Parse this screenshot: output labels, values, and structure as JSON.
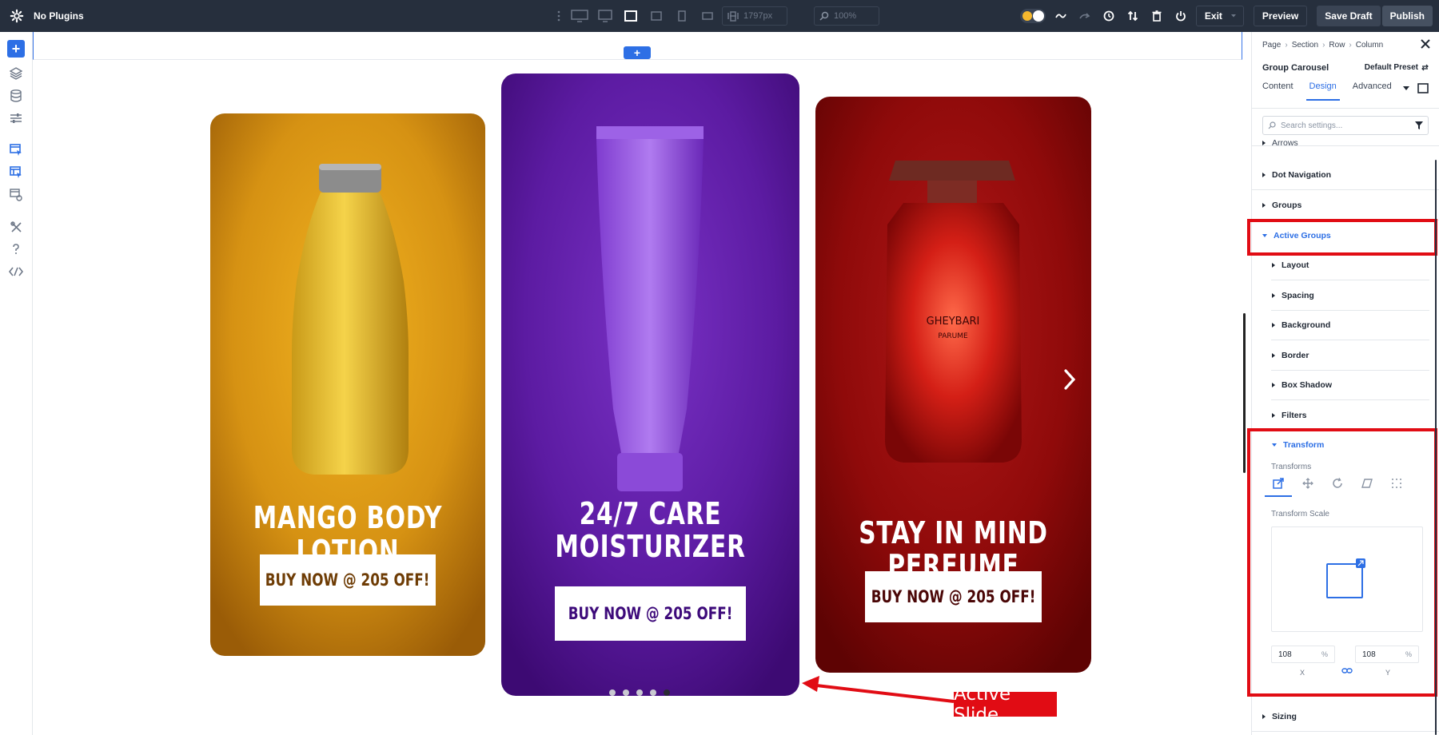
{
  "topbar": {
    "title": "No Plugins",
    "width_field": "1797px",
    "zoom_field": "100%",
    "exit_label": "Exit",
    "preview_label": "Preview",
    "save_draft_label": "Save Draft",
    "publish_label": "Publish"
  },
  "canvas": {
    "cards": [
      {
        "title_line1": "MANGO BODY LOTION",
        "title_line2": "",
        "button": "BUY NOW @ 205 OFF!",
        "color": "#c8870f",
        "text_color": "#6e3c05"
      },
      {
        "title_line1": "24/7 CARE",
        "title_line2": "MOISTURIZER",
        "button": "BUY NOW @ 205 OFF!",
        "color": "#5b1d9e",
        "text_color": "#3d0a7a"
      },
      {
        "title_line1": "STAY IN MIND",
        "title_line2": "PERFUME",
        "button": "BUY NOW @ 205 OFF!",
        "color": "#9e0d0d",
        "text_color": "#4a0606"
      }
    ],
    "perfume_label_1": "GHEYBARI",
    "perfume_label_2": "PARUME",
    "dots": {
      "count": 5,
      "active_index": 4
    },
    "annotation": "Active Slide"
  },
  "panel": {
    "breadcrumb": [
      "Page",
      "Section",
      "Row",
      "Column"
    ],
    "module_name": "Group Carousel",
    "preset": "Default Preset",
    "tabs": [
      "Content",
      "Design",
      "Advanced"
    ],
    "active_tab": "Design",
    "search_placeholder": "Search settings...",
    "partial_top": "Arrows",
    "sections": {
      "dot_navigation": "Dot Navigation",
      "groups": "Groups",
      "active_groups": "Active Groups",
      "layout": "Layout",
      "spacing": "Spacing",
      "background": "Background",
      "border": "Border",
      "box_shadow": "Box Shadow",
      "filters": "Filters",
      "transform": "Transform",
      "sizing": "Sizing"
    },
    "transform": {
      "transforms_label": "Transforms",
      "scale_label": "Transform Scale",
      "x_value": "108",
      "y_value": "108",
      "unit": "%",
      "x_label": "X",
      "y_label": "Y"
    }
  },
  "colors": {
    "accent": "#2d6fe5",
    "highlight": "#e10c14",
    "topbar": "#262f3d"
  }
}
